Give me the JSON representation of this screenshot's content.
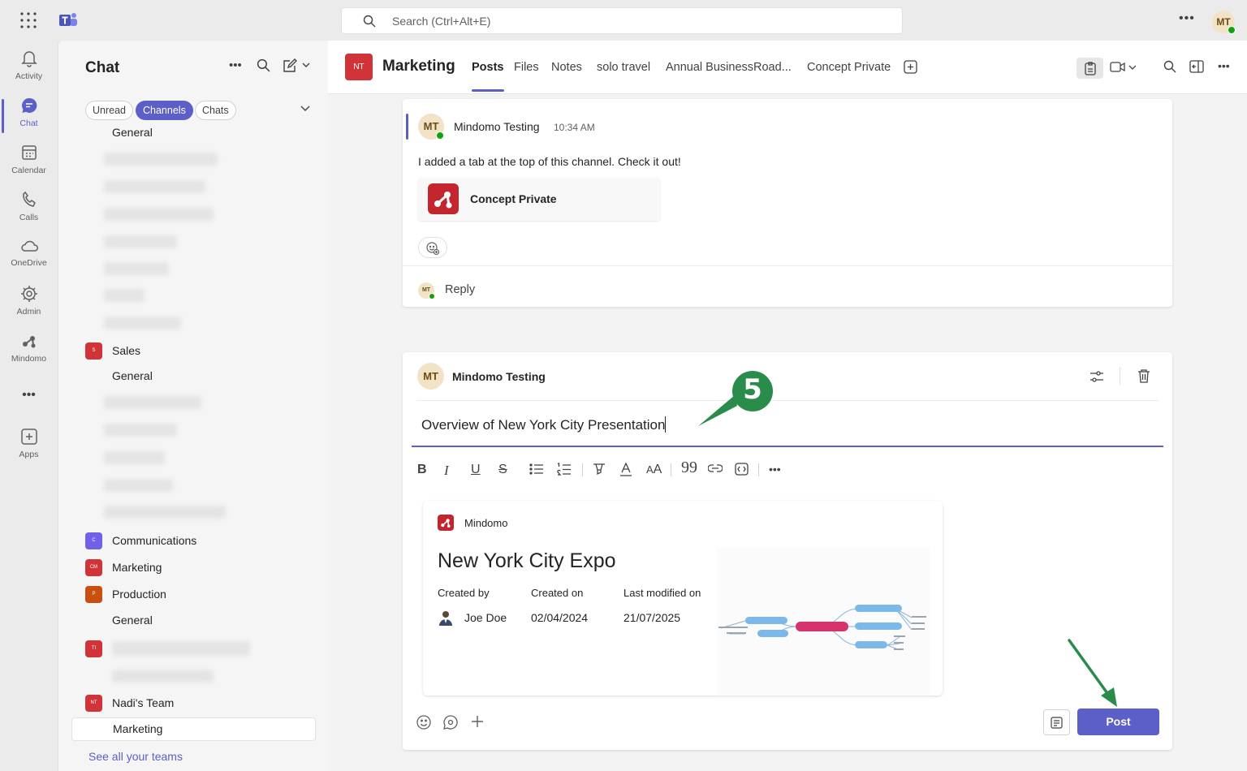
{
  "titlebar": {
    "search_placeholder": "Search (Ctrl+Alt+E)",
    "user_initials": "MT"
  },
  "rail": [
    {
      "label": "Activity",
      "icon": "bell-icon"
    },
    {
      "label": "Chat",
      "icon": "chat-icon",
      "active": true
    },
    {
      "label": "Calendar",
      "icon": "calendar-icon"
    },
    {
      "label": "Calls",
      "icon": "phone-icon"
    },
    {
      "label": "OneDrive",
      "icon": "cloud-icon"
    },
    {
      "label": "Admin",
      "icon": "admin-gear-icon"
    },
    {
      "label": "Mindomo",
      "icon": "mindomo-icon"
    },
    {
      "label": "Apps",
      "icon": "apps-plus-icon"
    }
  ],
  "chat_pane": {
    "title": "Chat",
    "filters": [
      "Unread",
      "Channels",
      "Chats"
    ],
    "active_filter": "Channels",
    "items": {
      "general_1": "General",
      "team_sales": "Sales",
      "general_2": "General",
      "team_communications": "Communications",
      "team_marketing": "Marketing",
      "team_production": "Production",
      "general_3": "General",
      "team_nadis": "Nadi's Team",
      "channel_marketing": "Marketing"
    },
    "team_badges": {
      "sales": "S",
      "communications": "C",
      "marketing": "CM",
      "production": "P",
      "blurred": "TI",
      "nadis": "NT"
    },
    "see_all": "See all your teams"
  },
  "channel": {
    "badge": "NT",
    "name": "Marketing",
    "tabs": [
      "Posts",
      "Files",
      "Notes",
      "solo travel",
      "Annual BusinessRoad...",
      "Concept Private"
    ],
    "active_tab": "Posts"
  },
  "message": {
    "initials": "MT",
    "author": "Mindomo Testing",
    "time": "10:34 AM",
    "text": "I added a tab at the top of this channel. Check it out!",
    "tab_card_label": "Concept Private",
    "reply_initials": "MT",
    "reply_label": "Reply"
  },
  "composer": {
    "initials": "MT",
    "author": "Mindomo Testing",
    "subject": "Overview of New York City Presentation",
    "card": {
      "brand": "Mindomo",
      "title": "New York City Expo",
      "created_by_label": "Created by",
      "created_by": "Joe Doe",
      "created_on_label": "Created on",
      "created_on": "02/04/2024",
      "modified_label": "Last modified on",
      "modified": "21/07/2025"
    },
    "post_label": "Post"
  },
  "annotation": {
    "step_number": "5",
    "color": "#2a8c4a"
  },
  "colors": {
    "accent": "#5b5fc7",
    "team_red": "#d13438",
    "team_purple": "#7160e8",
    "team_orange": "#ca5010",
    "mindomo_red": "#c4262e"
  }
}
